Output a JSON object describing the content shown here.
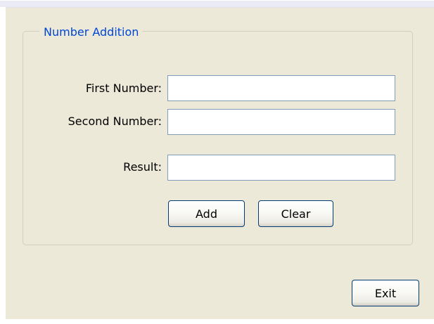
{
  "group": {
    "title": "Number Addition"
  },
  "fields": {
    "first_label": "First Number:",
    "first_value": "",
    "second_label": "Second Number:",
    "second_value": "",
    "result_label": "Result:",
    "result_value": ""
  },
  "buttons": {
    "add": "Add",
    "clear": "Clear",
    "exit": "Exit"
  },
  "colors": {
    "window_bg": "#ece9d8",
    "group_title": "#0046d5",
    "input_border": "#7f9db9",
    "button_border": "#003c74"
  }
}
